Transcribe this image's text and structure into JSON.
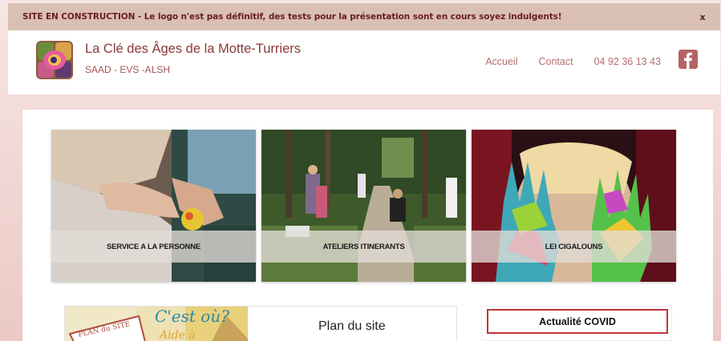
{
  "banner": {
    "text": "SITE EN CONSTRUCTION - Le logo n'est pas définitif, des tests pour la présentation sont en cours soyez indulgents!",
    "close_label": "x"
  },
  "header": {
    "title": "La Clé des Âges de la Motte-Turriers",
    "subtitle": "SAAD - EVS -ALSH",
    "nav": [
      {
        "label": "Accueil"
      },
      {
        "label": "Contact"
      },
      {
        "label": "04 92 36 13 43"
      }
    ],
    "social_icon": "facebook-icon"
  },
  "cards": [
    {
      "label": "SERVICE A LA PERSONNE"
    },
    {
      "label": "ATELIERS ITINERANTS"
    },
    {
      "label": "LEI CIGALOUNS"
    }
  ],
  "plan": {
    "title": "Plan du site",
    "image_text_1": "C'est où?",
    "image_text_2": "PLAN du SITE",
    "image_text_3": "Aide à"
  },
  "covid": {
    "label": "Actualité COVID"
  },
  "colors": {
    "banner_bg": "#d9c0b3",
    "banner_text": "#6a1d1d",
    "title": "#8a3a3a",
    "nav": "#b66d6d",
    "accent_red": "#c0353a"
  }
}
